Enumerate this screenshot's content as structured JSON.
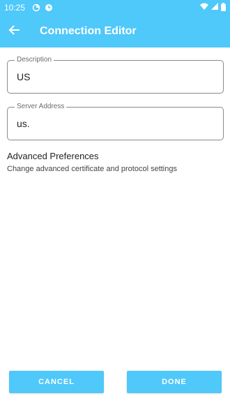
{
  "status_bar": {
    "time": "10:25",
    "icons_left": [
      "sync-icon",
      "app-notification-icon"
    ],
    "icons_right": [
      "wifi-icon",
      "signal-icon",
      "battery-icon"
    ]
  },
  "app_bar": {
    "title": "Connection Editor",
    "back_icon": "arrow-back-icon",
    "color": "#4fc8fa"
  },
  "form": {
    "description": {
      "label": "Description",
      "value": "US"
    },
    "server_address": {
      "label": "Server Address",
      "value": "us."
    }
  },
  "advanced": {
    "title": "Advanced Preferences",
    "subtitle": "Change advanced certificate and protocol settings"
  },
  "actions": {
    "cancel_label": "CANCEL",
    "done_label": "DONE"
  }
}
